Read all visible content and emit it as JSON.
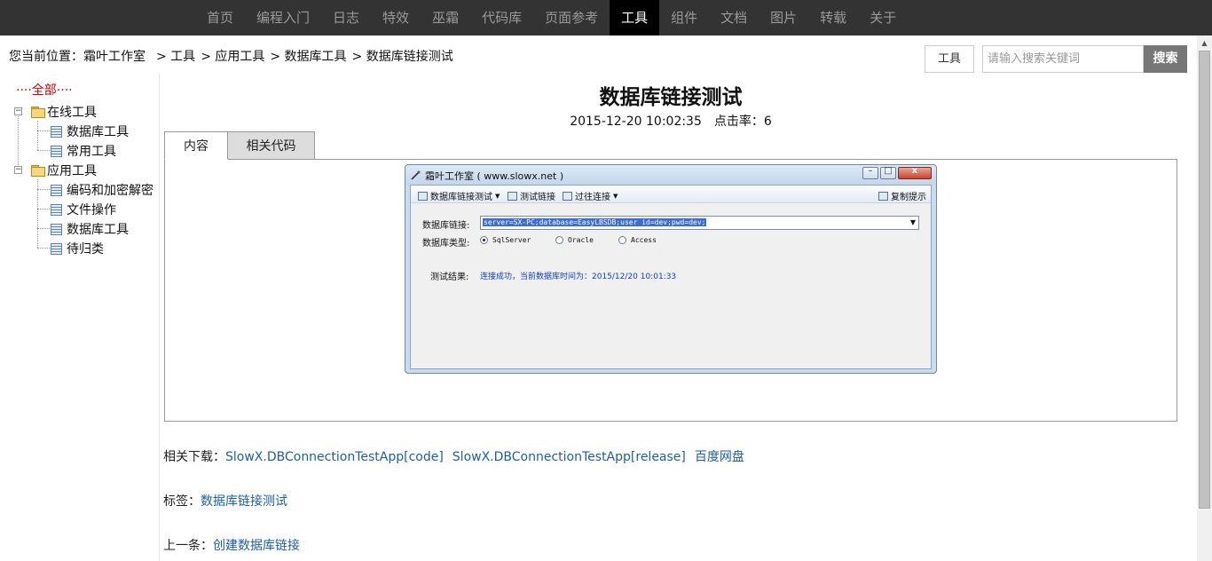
{
  "nav": {
    "items": [
      "首页",
      "编程入门",
      "日志",
      "特效",
      "巫霜",
      "代码库",
      "页面参考",
      "工具",
      "组件",
      "文档",
      "图片",
      "转载",
      "关于"
    ],
    "active": "工具"
  },
  "breadcrumb": {
    "prefix": "您当前位置：",
    "site": "霜叶工作室",
    "crumbs": [
      "> 工具",
      "> 应用工具",
      "> 数据库工具",
      "> 数据库链接测试"
    ]
  },
  "search": {
    "scope": "工具",
    "placeholder": "请输入搜索关键词",
    "button": "搜索"
  },
  "sidebar": {
    "all": "····全部····",
    "groups": [
      {
        "label": "在线工具",
        "items": [
          "数据库工具",
          "常用工具"
        ]
      },
      {
        "label": "应用工具",
        "items": [
          "编码和加密解密",
          "文件操作",
          "数据库工具",
          "待归类"
        ]
      }
    ],
    "expander_glyph": "−"
  },
  "article": {
    "title": "数据库链接测试",
    "date": "2015-12-20 10:02:35",
    "hits": "点击率：6",
    "tabs": [
      "内容",
      "相关代码"
    ]
  },
  "app": {
    "title": "霜叶工作室 ( www.slowx.net )",
    "toolbar": {
      "db_test": "数据库链接测试",
      "test_link": "测试链接",
      "filter_link": "过往连接",
      "copy_tip": "复制提示"
    },
    "conn_label": "数据库链接:",
    "conn_value": "server=SX-PC;database=EasyLBSDB;user id=dev;pwd=dev;",
    "type_label": "数据库类型:",
    "db_types": [
      "SqlServer",
      "Oracle",
      "Access"
    ],
    "db_type_selected": "SqlServer",
    "result_label": "测试结果:",
    "result_text": "连接成功，当前数据库时间为：2015/12/20 10:01:33",
    "win_buttons": {
      "minimize": "–",
      "maximize": "□",
      "close": "x"
    }
  },
  "downloads": {
    "label": "相关下载：",
    "links": [
      "SlowX.DBConnectionTestApp[code]",
      "SlowX.DBConnectionTestApp[release]",
      "百度网盘"
    ]
  },
  "tags": {
    "label": "标签：",
    "value": "数据库链接测试"
  },
  "prev": {
    "label": "上一条：",
    "value": "创建数据库链接"
  },
  "scrollbar": {
    "up_glyph": "▲"
  },
  "colors": {
    "nav_bg": "#333333",
    "link": "#1d5fa6",
    "tree_all": "#cc0000",
    "result_text": "#1040c8"
  }
}
